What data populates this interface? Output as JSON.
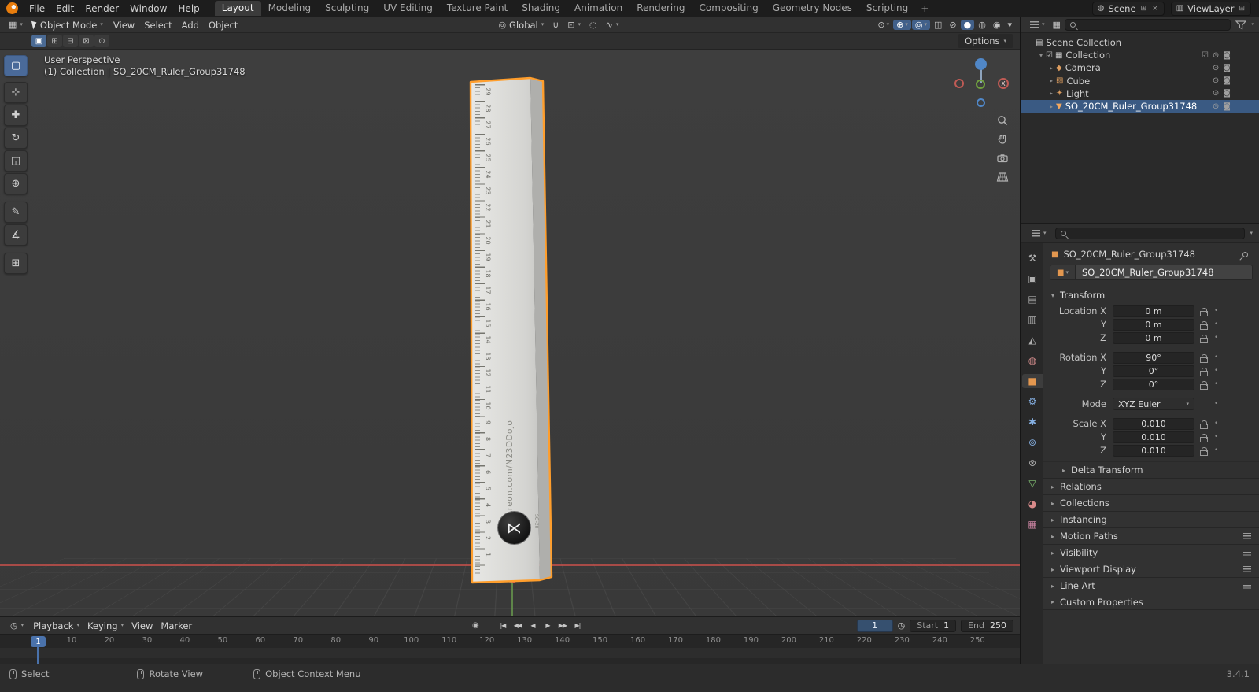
{
  "ui": {
    "chevron": "▾",
    "expand_open": "▾",
    "expand_closed": "▸",
    "dot": "•",
    "viewport_icon": "▦",
    "orientation_icon": "◎",
    "magnet_icon": "∪",
    "snap_icon": "⊡",
    "proportional_icon": "◌",
    "falloff_icon": "∿",
    "clock_icon": "◷",
    "display_mode_icon": "▦",
    "object_icon": "■",
    "scene_icon": "◍",
    "view_layer_icon": "▥",
    "new_icon": "⊞",
    "close_icon": "×"
  },
  "topbar": {
    "app_menus": [
      "File",
      "Edit",
      "Render",
      "Window",
      "Help"
    ],
    "workspaces": [
      {
        "label": "Layout",
        "active": true
      },
      {
        "label": "Modeling"
      },
      {
        "label": "Sculpting"
      },
      {
        "label": "UV Editing"
      },
      {
        "label": "Texture Paint"
      },
      {
        "label": "Shading"
      },
      {
        "label": "Animation"
      },
      {
        "label": "Rendering"
      },
      {
        "label": "Compositing"
      },
      {
        "label": "Geometry Nodes"
      },
      {
        "label": "Scripting"
      }
    ],
    "add_workspace": "+",
    "scene": {
      "label": "Scene"
    },
    "view_layer": {
      "label": "ViewLayer"
    }
  },
  "viewport_header": {
    "mode": "Object Mode",
    "menus": [
      "View",
      "Select",
      "Add",
      "Object"
    ],
    "orientation": "Global",
    "right_icons": [
      {
        "name": "show-object-types",
        "glyph": "⊙",
        "chev": true
      },
      {
        "name": "show-gizmos",
        "glyph": "⊕",
        "chev": true,
        "active": true
      },
      {
        "name": "show-overlays",
        "glyph": "◎",
        "chev": true,
        "active": true
      },
      {
        "name": "toggle-xray",
        "glyph": "◫"
      },
      {
        "name": "shading-wireframe",
        "glyph": "⊘"
      },
      {
        "name": "shading-solid",
        "glyph": "●",
        "active": true
      },
      {
        "name": "shading-material-preview",
        "glyph": "◍"
      },
      {
        "name": "shading-rendered",
        "glyph": "◉"
      },
      {
        "name": "shading-options",
        "glyph": "▾"
      }
    ]
  },
  "tool_settings": {
    "options_label": "Options",
    "modes": [
      {
        "name": "select-set",
        "glyph": "▣",
        "active": true
      },
      {
        "name": "select-extend",
        "glyph": "⊞"
      },
      {
        "name": "select-subtract",
        "glyph": "⊟"
      },
      {
        "name": "select-difference",
        "glyph": "⊠"
      },
      {
        "name": "select-intersect",
        "glyph": "⊙"
      }
    ]
  },
  "toolbar": {
    "tools": [
      {
        "name": "select-box",
        "glyph": "▢",
        "active": true
      },
      {
        "name": "cursor",
        "glyph": "⊹"
      },
      {
        "name": "move",
        "glyph": "✚"
      },
      {
        "name": "rotate",
        "glyph": "↻"
      },
      {
        "name": "scale",
        "glyph": "◱"
      },
      {
        "name": "transform",
        "glyph": "⊕"
      },
      {
        "name": "annotate",
        "glyph": "✎"
      },
      {
        "name": "measure",
        "glyph": "∡"
      },
      {
        "name": "add-cube",
        "glyph": "⊞"
      }
    ]
  },
  "viewport": {
    "overlay_line1": "User Perspective",
    "overlay_line2": "(1) Collection | SO_20CM_Ruler_Group31748",
    "gizmo": {
      "x_label": "X"
    },
    "ruler": {
      "numbers": [
        1,
        2,
        3,
        4,
        5,
        6,
        7,
        8,
        9,
        10,
        11,
        12,
        13,
        14,
        15,
        16,
        17,
        18,
        19,
        20,
        21,
        22,
        23,
        24,
        25,
        26,
        27,
        28,
        29
      ],
      "brand": "patreon.com/N23DDojo",
      "badge": "SO-20",
      "logo_glyph": "⋉"
    }
  },
  "outliner": {
    "search_placeholder": "",
    "rows": [
      {
        "label": "Scene Collection",
        "level": 0,
        "icon": "scene-collection",
        "glyph": "▤",
        "arrow": "",
        "toggles": []
      },
      {
        "label": "Collection",
        "level": 1,
        "icon": "collection",
        "glyph": "▦",
        "arrow": "▾",
        "checkbox": true,
        "toggles": [
          "checkbox",
          "eye",
          "render"
        ]
      },
      {
        "label": "Camera",
        "level": 2,
        "icon": "camera",
        "glyph": "◆",
        "arrow": "▸",
        "toggles": [
          "eye",
          "render"
        ]
      },
      {
        "label": "Cube",
        "level": 2,
        "icon": "cube",
        "glyph": "▧",
        "arrow": "▸",
        "toggles": [
          "eye",
          "render"
        ]
      },
      {
        "label": "Light",
        "level": 2,
        "icon": "light",
        "glyph": "☀",
        "arrow": "▸",
        "toggles": [
          "eye",
          "render"
        ]
      },
      {
        "label": "SO_20CM_Ruler_Group31748",
        "level": 2,
        "icon": "mesh",
        "glyph": "▼",
        "arrow": "▸",
        "selected": true,
        "toggles": [
          "eye",
          "render"
        ]
      }
    ]
  },
  "properties": {
    "search_placeholder": "",
    "breadcrumb": "SO_20CM_Ruler_Group31748",
    "name_field": "SO_20CM_Ruler_Group31748",
    "tabs": [
      {
        "name": "tool",
        "glyph": "⚒",
        "color": "#b0b0b0"
      },
      {
        "name": "render",
        "glyph": "▣",
        "color": "#b0b0b0"
      },
      {
        "name": "output",
        "glyph": "▤",
        "color": "#b0b0b0"
      },
      {
        "name": "view-layer",
        "glyph": "▥",
        "color": "#b0b0b0"
      },
      {
        "name": "scene",
        "glyph": "◭",
        "color": "#b0b0b0"
      },
      {
        "name": "world",
        "glyph": "◍",
        "color": "#cf8a8a"
      },
      {
        "name": "object",
        "glyph": "■",
        "color": "#e3974f",
        "active": true
      },
      {
        "name": "modifiers",
        "glyph": "⚙",
        "color": "#84aee0"
      },
      {
        "name": "particles",
        "glyph": "✱",
        "color": "#84aee0"
      },
      {
        "name": "physics",
        "glyph": "⊚",
        "color": "#84aee0"
      },
      {
        "name": "constraints",
        "glyph": "⊗",
        "color": "#b0b0b0"
      },
      {
        "name": "object-data",
        "glyph": "▽",
        "color": "#86c776"
      },
      {
        "name": "material",
        "glyph": "◕",
        "color": "#d88a8a"
      },
      {
        "name": "texture",
        "glyph": "▦",
        "color": "#cf86a5"
      }
    ],
    "transform": {
      "title": "Transform",
      "location_rows": [
        {
          "label": "Location X",
          "value": "0 m"
        },
        {
          "label": "Y",
          "value": "0 m"
        },
        {
          "label": "Z",
          "value": "0 m"
        }
      ],
      "rotation_rows": [
        {
          "label": "Rotation X",
          "value": "90°"
        },
        {
          "label": "Y",
          "value": "0°"
        },
        {
          "label": "Z",
          "value": "0°"
        }
      ],
      "mode": {
        "label": "Mode",
        "value": "XYZ Euler"
      },
      "scale_rows": [
        {
          "label": "Scale X",
          "value": "0.010"
        },
        {
          "label": "Y",
          "value": "0.010"
        },
        {
          "label": "Z",
          "value": "0.010"
        }
      ],
      "subpanel": "Delta Transform"
    },
    "sections": [
      {
        "label": "Relations"
      },
      {
        "label": "Collections"
      },
      {
        "label": "Instancing"
      },
      {
        "label": "Motion Paths",
        "menu": true
      },
      {
        "label": "Visibility",
        "menu": true
      },
      {
        "label": "Viewport Display",
        "menu": true
      },
      {
        "label": "Line Art",
        "menu": true
      },
      {
        "label": "Custom Properties"
      }
    ]
  },
  "timeline": {
    "menus": [
      "Playback",
      "Keying",
      "View",
      "Marker"
    ],
    "menus_chev": [
      true,
      true,
      false,
      false
    ],
    "record_glyph": "◉",
    "transport": [
      {
        "name": "jump-to-start",
        "glyph": "|◀"
      },
      {
        "name": "prev-keyframe",
        "glyph": "◀◀"
      },
      {
        "name": "play-reverse",
        "glyph": "◀"
      },
      {
        "name": "play",
        "glyph": "▶"
      },
      {
        "name": "next-keyframe",
        "glyph": "▶▶"
      },
      {
        "name": "jump-to-end",
        "glyph": "▶|"
      }
    ],
    "current_frame": "1",
    "start": {
      "label": "Start",
      "value": "1"
    },
    "end": {
      "label": "End",
      "value": "250"
    },
    "ticks": [
      1,
      10,
      20,
      30,
      40,
      50,
      60,
      70,
      80,
      90,
      100,
      110,
      120,
      130,
      140,
      150,
      160,
      170,
      180,
      190,
      200,
      210,
      220,
      230,
      240,
      250
    ]
  },
  "statusbar": {
    "hints": [
      {
        "label": "Select"
      },
      {
        "label": "Rotate View"
      },
      {
        "label": "Object Context Menu"
      }
    ],
    "version": "3.4.1"
  }
}
